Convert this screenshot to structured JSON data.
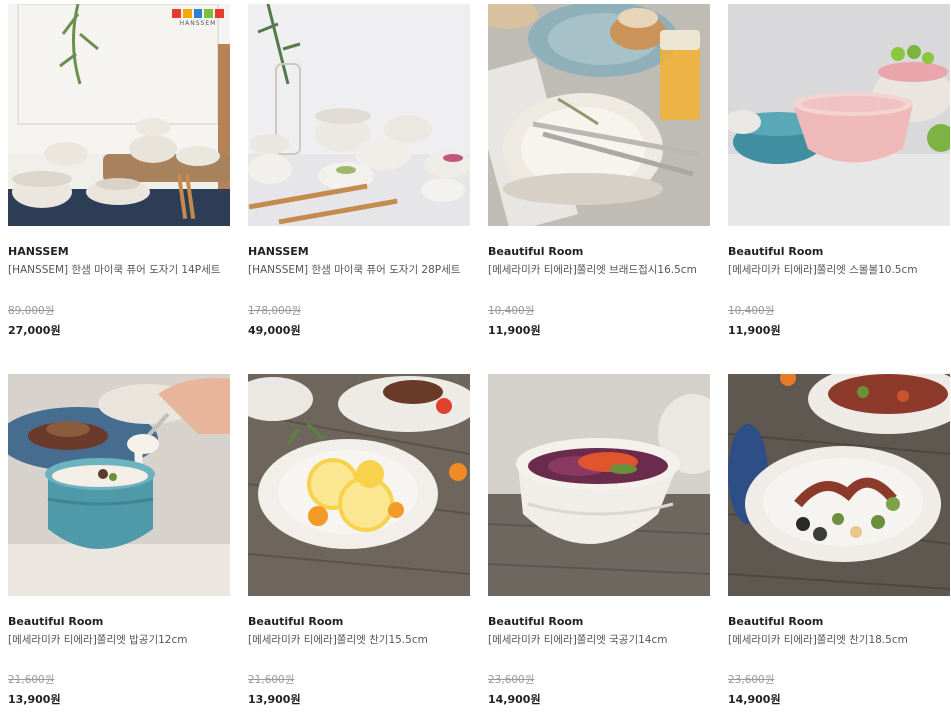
{
  "products": [
    {
      "brand": "HANSSEM",
      "title": "[HANSSEM] 한샘 마이쿡 퓨어 도자기 14P세트",
      "original_price": "89,000원",
      "price": "27,000원",
      "image": "ceramic-bowl-set-white"
    },
    {
      "brand": "HANSSEM",
      "title": "[HANSSEM] 한샘 마이쿡 퓨어 도자기 28P세트",
      "original_price": "178,000원",
      "price": "49,000원",
      "image": "ceramic-bowl-set-large"
    },
    {
      "brand": "Beautiful Room",
      "title": "[메세라미카 티에라]쫄리엣 브래드접시16.5cm",
      "original_price": "10,400원",
      "price": "11,900원",
      "image": "bread-plate-with-fork"
    },
    {
      "brand": "Beautiful Room",
      "title": "[메세라미카 티에라]쫄리엣 스몰볼10.5cm",
      "original_price": "10,400원",
      "price": "11,900원",
      "image": "pink-small-bowl"
    },
    {
      "brand": "Beautiful Room",
      "title": "[메세라미카 티에라]쫄리엣 밥공기12cm",
      "original_price": "21,600원",
      "price": "13,900원",
      "image": "teal-rice-bowl-with-spoon"
    },
    {
      "brand": "Beautiful Room",
      "title": "[메세라미카 티에라]쫄리엣 찬기15.5cm",
      "original_price": "21,600원",
      "price": "13,900원",
      "image": "side-dish-bowl-lemons"
    },
    {
      "brand": "Beautiful Room",
      "title": "[메세라미카 티에라]쫄리엣 국공기14cm",
      "original_price": "23,600원",
      "price": "14,900원",
      "image": "soup-bowl-salad"
    },
    {
      "brand": "Beautiful Room",
      "title": "[메세라미카 티에라]쫄리엣 찬기18.5cm",
      "original_price": "23,600원",
      "price": "14,900원",
      "image": "side-dish-bowl-octopus"
    }
  ],
  "logo": {
    "text": "HANSSEM",
    "colors": [
      "#e63b2e",
      "#f2a900",
      "#2e7dd7",
      "#7fbf3f",
      "#e63b2e"
    ]
  },
  "colors": {
    "brand_text": "#222222",
    "title_text": "#555555",
    "strike_text": "#999999",
    "price_text": "#222222"
  }
}
